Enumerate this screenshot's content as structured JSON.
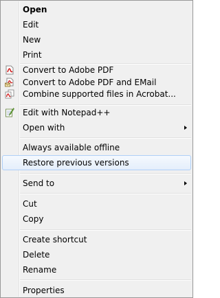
{
  "menu": {
    "items": [
      {
        "label": "Open"
      },
      {
        "label": "Edit"
      },
      {
        "label": "New"
      },
      {
        "label": "Print"
      },
      {
        "label": "Convert to Adobe PDF",
        "icon": "adobe-pdf-icon"
      },
      {
        "label": "Convert to Adobe PDF and EMail",
        "icon": "adobe-pdf-email-icon"
      },
      {
        "label": "Combine supported files in Acrobat...",
        "icon": "acrobat-combine-icon"
      },
      {
        "label": "Edit with Notepad++",
        "icon": "notepad-plus-plus-icon"
      },
      {
        "label": "Open with"
      },
      {
        "label": "Always available offline"
      },
      {
        "label": "Restore previous versions"
      },
      {
        "label": "Send to"
      },
      {
        "label": "Cut"
      },
      {
        "label": "Copy"
      },
      {
        "label": "Create shortcut"
      },
      {
        "label": "Delete"
      },
      {
        "label": "Rename"
      },
      {
        "label": "Properties"
      }
    ],
    "hovered_item": "Restore previous versions",
    "default_item": "Open"
  },
  "colors": {
    "menu_background": "#f0f0f0",
    "menu_border": "#979797",
    "hover_border": "#aecff7",
    "adobe_red": "#d02020"
  }
}
